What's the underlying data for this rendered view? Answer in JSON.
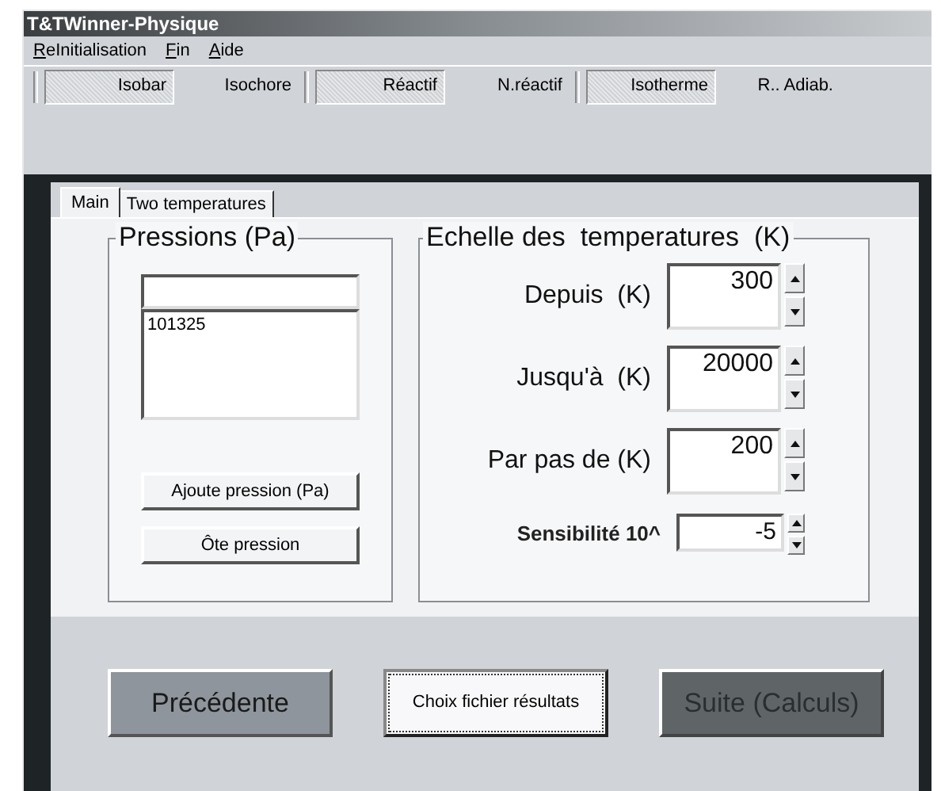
{
  "window": {
    "title": "T&TWinner-Physique"
  },
  "menu": [
    {
      "label": "ReInitialisation",
      "mnemonic_underlined": true
    },
    {
      "label": "Fin",
      "mnemonic_underlined": true
    },
    {
      "label": "Aide",
      "mnemonic_underlined": true
    }
  ],
  "toolbar": [
    {
      "label": "Isobar",
      "selected": true
    },
    {
      "label": "Isochore",
      "selected": false
    },
    {
      "label": "Réactif",
      "selected": true
    },
    {
      "label": "N.réactif",
      "selected": false
    },
    {
      "label": "Isotherme",
      "selected": true
    },
    {
      "label": "R.. Adiab.",
      "selected": false
    }
  ],
  "tabs": [
    {
      "label": "Main",
      "selected": true
    },
    {
      "label": "Two temperatures",
      "selected": false
    }
  ],
  "pressures": {
    "title": "Pressions (Pa)",
    "list": [
      "101325"
    ],
    "buttons": [
      "Ajoute pression (Pa)",
      "Ôte pression"
    ]
  },
  "temperatures": {
    "title": "Echelle des  temperatures  (K)",
    "fields": [
      {
        "label": "Depuis  (K)",
        "value": "300",
        "kind": "large"
      },
      {
        "label": "Jusqu'à  (K)",
        "value": "20000",
        "kind": "large"
      },
      {
        "label": "Par pas de (K)",
        "value": "200",
        "kind": "large"
      },
      {
        "label": "Sensibilité 10^",
        "value": "-5",
        "kind": "small"
      }
    ]
  },
  "buttons": [
    {
      "label": "Précédente",
      "kind": "secondary"
    },
    {
      "label": "Choix fichier résultats",
      "kind": "focused"
    },
    {
      "label": "Suite (Calculs)",
      "kind": "disabled"
    }
  ]
}
